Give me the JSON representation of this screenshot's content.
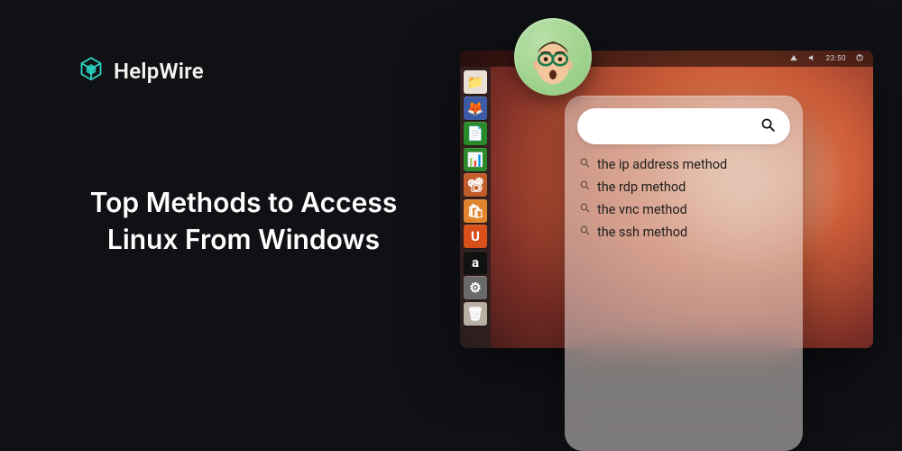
{
  "brand": {
    "name": "HelpWire"
  },
  "headline": "Top Methods to Access Linux From Windows",
  "desktop": {
    "menubar": {
      "clock": "23:50"
    },
    "dock": [
      {
        "name": "files",
        "bg": "#e9e1d6",
        "glyph": "📁"
      },
      {
        "name": "firefox",
        "bg": "#3c5aa6",
        "glyph": "🦊"
      },
      {
        "name": "writer",
        "bg": "#2a8a2a",
        "glyph": "📄"
      },
      {
        "name": "calc",
        "bg": "#2a8a2a",
        "glyph": "📊"
      },
      {
        "name": "impress",
        "bg": "#c25b2a",
        "glyph": "📽"
      },
      {
        "name": "software",
        "bg": "#e0842e",
        "glyph": "🛍"
      },
      {
        "name": "ubuntu-one",
        "bg": "#d94f1a",
        "glyph": "U"
      },
      {
        "name": "amazon",
        "bg": "#111111",
        "glyph": "a"
      },
      {
        "name": "settings",
        "bg": "#6a6a6a",
        "glyph": "⚙"
      },
      {
        "name": "trash",
        "bg": "#b9b0a4",
        "glyph": "🗑"
      }
    ]
  },
  "search": {
    "suggestions": [
      {
        "label": "the ip address method"
      },
      {
        "label": "the rdp method"
      },
      {
        "label": "the vnc method"
      },
      {
        "label": "the ssh method"
      }
    ]
  }
}
